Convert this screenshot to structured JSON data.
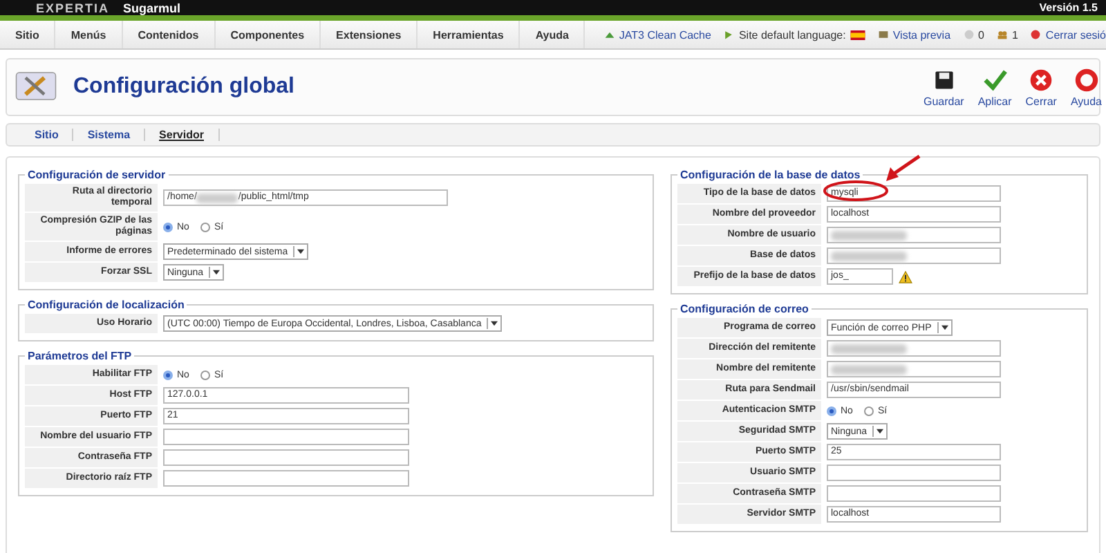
{
  "header": {
    "brand": "EXPERTIA",
    "site": "Sugarmul",
    "version": "Versión 1.5"
  },
  "menu": [
    "Sitio",
    "Menús",
    "Contenidos",
    "Componentes",
    "Extensiones",
    "Herramientas",
    "Ayuda"
  ],
  "status": {
    "cache": "JAT3 Clean Cache",
    "language": "Site default language:",
    "preview": "Vista previa",
    "messages": "0",
    "users": "1",
    "logout": "Cerrar sesió"
  },
  "page_title": "Configuración global",
  "toolbar": [
    "Guardar",
    "Aplicar",
    "Cerrar",
    "Ayuda"
  ],
  "tabs": [
    {
      "label": "Sitio",
      "selected": false
    },
    {
      "label": "Sistema",
      "selected": false
    },
    {
      "label": "Servidor",
      "selected": true
    }
  ],
  "left": [
    {
      "title": "Configuración de servidor",
      "rows": [
        {
          "kind": "path",
          "label": "Ruta al directorio temporal",
          "value_start": "/home/",
          "value_end": "/public_html/tmp"
        },
        {
          "kind": "radio",
          "label": "Compresión GZIP de las páginas",
          "options": [
            {
              "label": "No",
              "selected": true
            },
            {
              "label": "Sí",
              "selected": false
            }
          ]
        },
        {
          "kind": "select",
          "label": "Informe de errores",
          "value": "Predeterminado del sistema"
        },
        {
          "kind": "select",
          "label": "Forzar SSL",
          "value": "Ninguna"
        }
      ]
    },
    {
      "title": "Configuración de localización",
      "rows": [
        {
          "kind": "select",
          "label": "Uso Horario",
          "value": "(UTC 00:00) Tiempo de Europa Occidental, Londres, Lisboa, Casablanca"
        }
      ]
    },
    {
      "title": "Parámetros del FTP",
      "rows": [
        {
          "kind": "radio",
          "label": "Habilitar FTP",
          "options": [
            {
              "label": "No",
              "selected": true
            },
            {
              "label": "Sí",
              "selected": false
            }
          ]
        },
        {
          "kind": "text",
          "label": "Host FTP",
          "value": "127.0.0.1"
        },
        {
          "kind": "text",
          "label": "Puerto FTP",
          "value": "21"
        },
        {
          "kind": "text",
          "label": "Nombre del usuario FTP",
          "value": ""
        },
        {
          "kind": "text",
          "label": "Contraseña FTP",
          "value": ""
        },
        {
          "kind": "text",
          "label": "Directorio raíz FTP",
          "value": ""
        }
      ]
    }
  ],
  "right": [
    {
      "title": "Configuración de la base de datos",
      "rows": [
        {
          "kind": "text",
          "label": "Tipo de la base de datos",
          "value": "mysqli"
        },
        {
          "kind": "text",
          "label": "Nombre del proveedor",
          "value": "localhost"
        },
        {
          "kind": "blurred",
          "label": "Nombre de usuario"
        },
        {
          "kind": "blurred",
          "label": "Base de datos"
        },
        {
          "kind": "warn",
          "label": "Prefijo de la base de datos",
          "value": "jos_"
        }
      ]
    },
    {
      "title": "Configuración de correo",
      "rows": [
        {
          "kind": "select",
          "label": "Programa de correo",
          "value": "Función de correo PHP"
        },
        {
          "kind": "blurred",
          "label": "Dirección del remitente"
        },
        {
          "kind": "blurred",
          "label": "Nombre del remitente"
        },
        {
          "kind": "text",
          "label": "Ruta para Sendmail",
          "value": "/usr/sbin/sendmail"
        },
        {
          "kind": "radio",
          "label": "Autenticacion SMTP",
          "options": [
            {
              "label": "No",
              "selected": true
            },
            {
              "label": "Sí",
              "selected": false
            }
          ]
        },
        {
          "kind": "select",
          "label": "Seguridad SMTP",
          "value": "Ninguna"
        },
        {
          "kind": "text",
          "label": "Puerto SMTP",
          "value": "25"
        },
        {
          "kind": "text",
          "label": "Usuario SMTP",
          "value": ""
        },
        {
          "kind": "text",
          "label": "Contraseña SMTP",
          "value": ""
        },
        {
          "kind": "text",
          "label": "Servidor SMTP",
          "value": "localhost"
        }
      ]
    }
  ]
}
